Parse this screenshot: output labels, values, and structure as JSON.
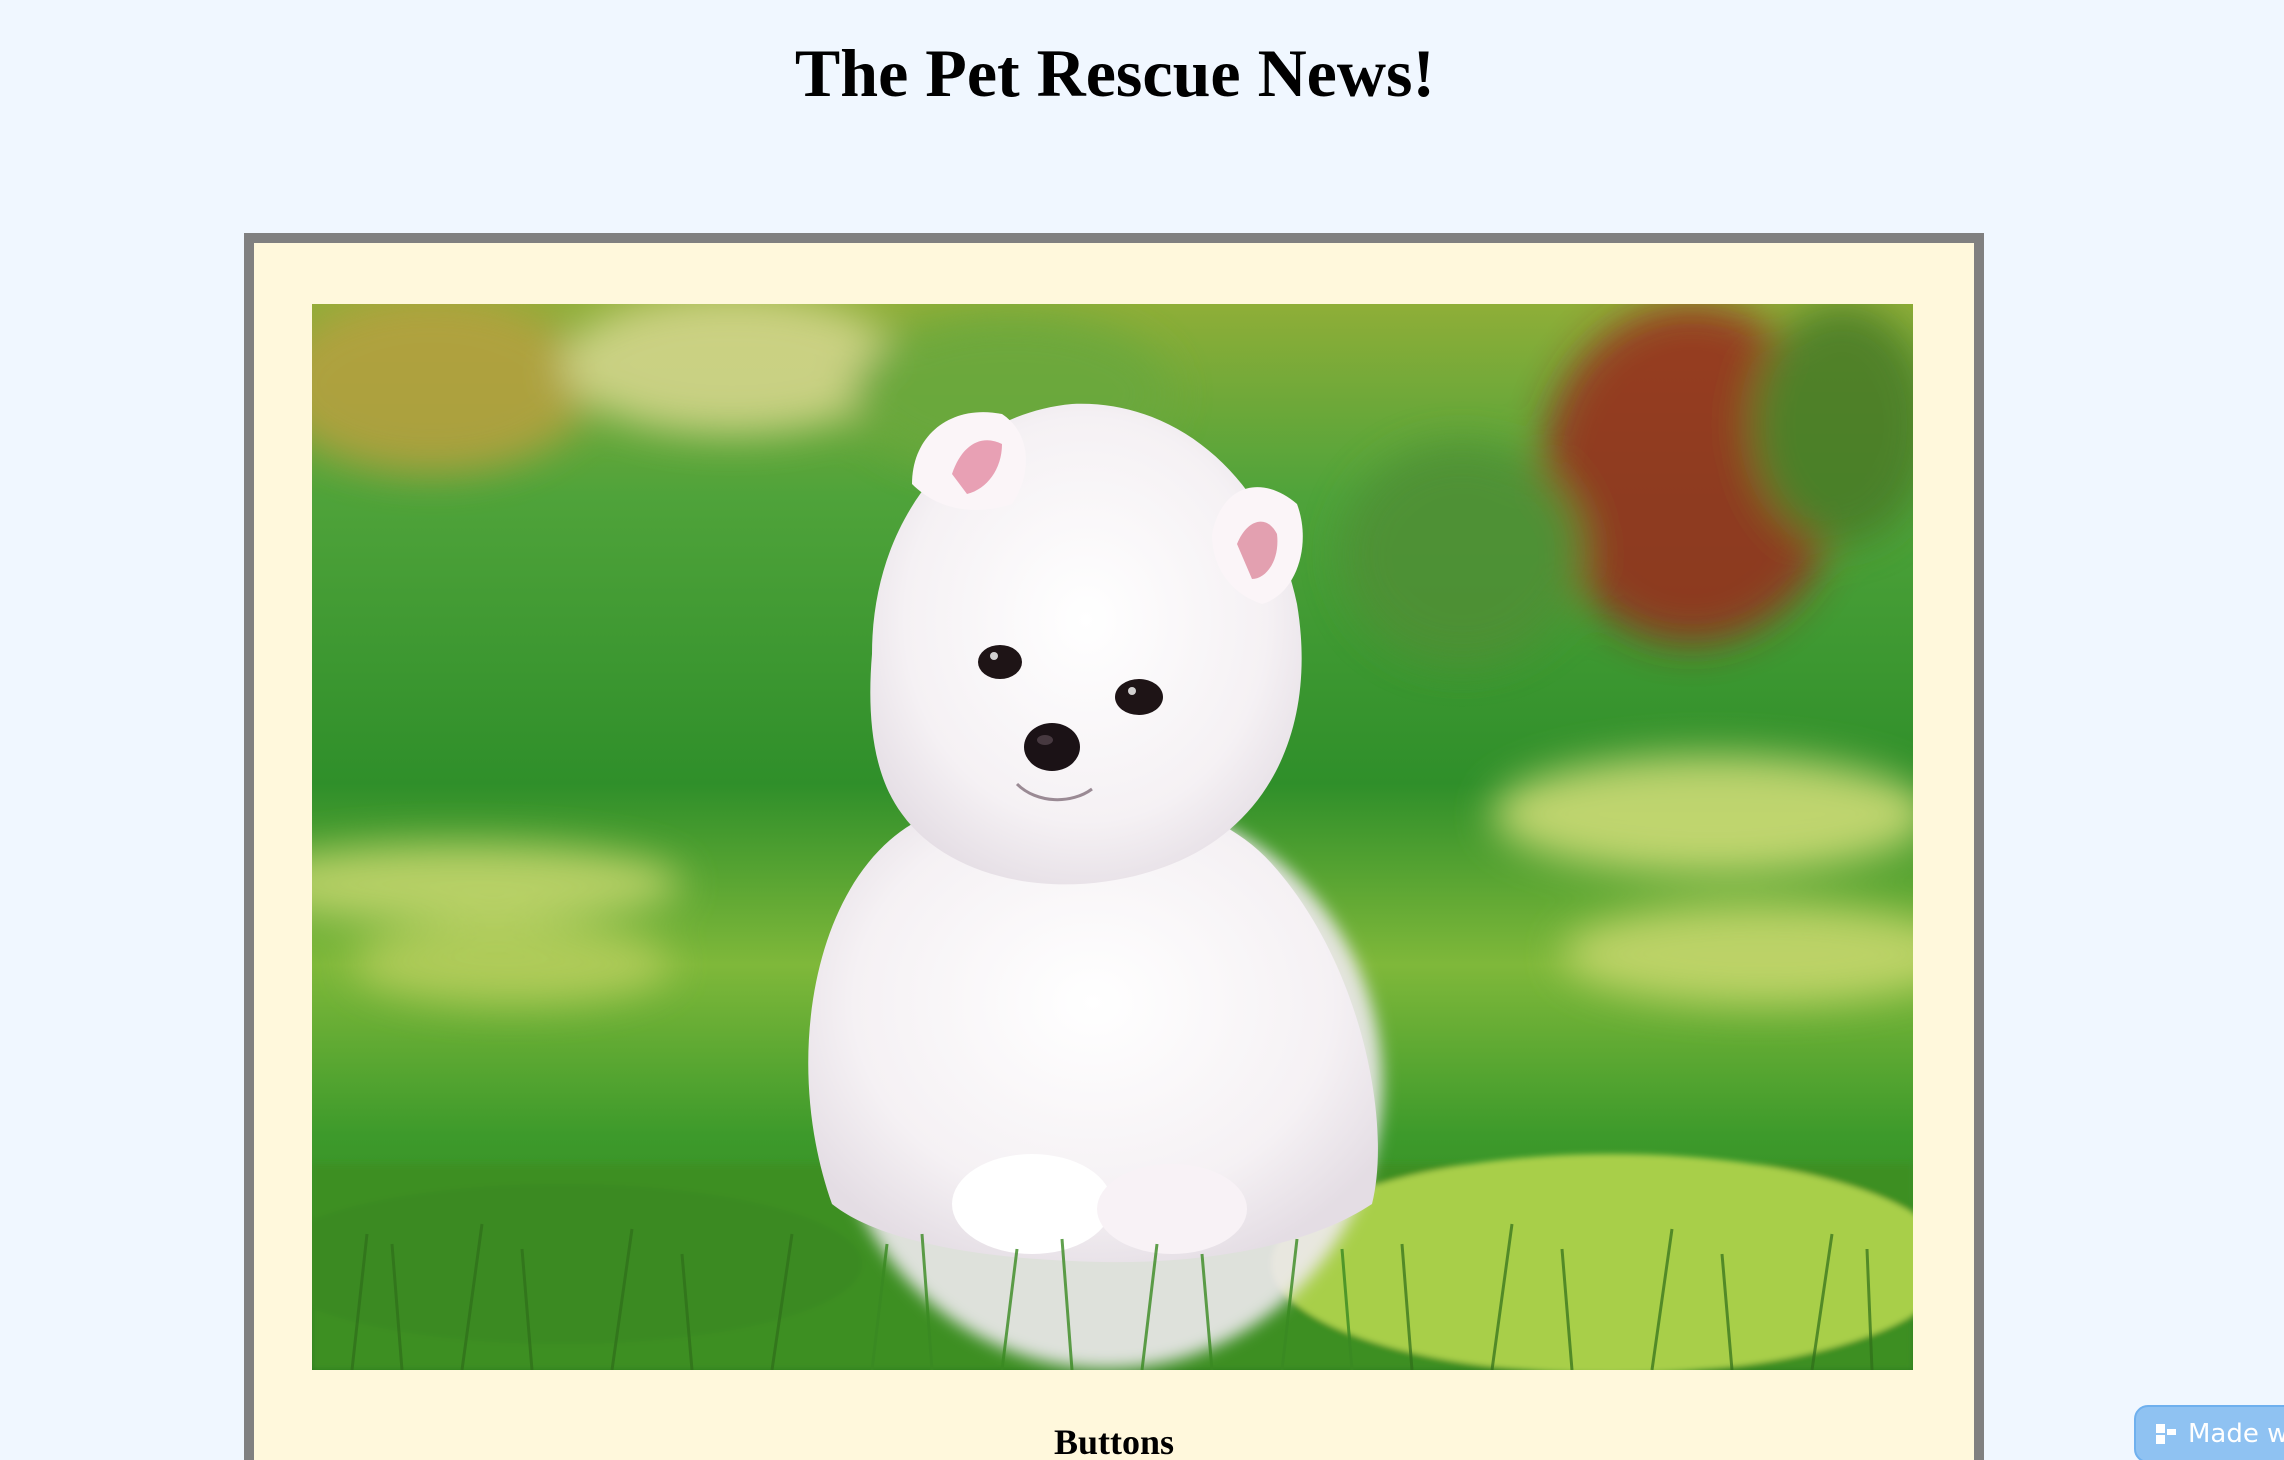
{
  "page": {
    "title": "The Pet Rescue News!",
    "background_color": "#f0f7ff"
  },
  "card": {
    "background_color": "#fff8dc",
    "border_color": "#808080",
    "photo": {
      "alt": "fluffy white puppy sitting on grass"
    },
    "section_heading": "Buttons"
  },
  "badge": {
    "label": "Made w",
    "icon": "editor-logo-icon",
    "color": "#8fc2f2"
  }
}
